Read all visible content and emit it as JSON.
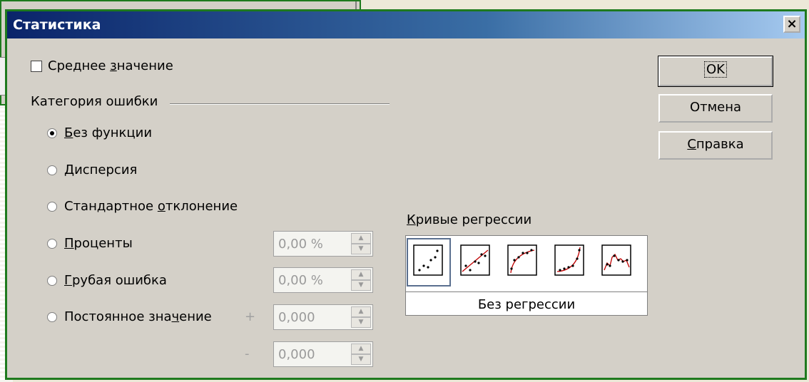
{
  "dialog": {
    "title": "Статистика",
    "close_label": "×"
  },
  "mean": {
    "label_pre": "Среднее ",
    "label_u": "з",
    "label_post": "начение",
    "checked": false
  },
  "error_category": {
    "label": "Категория ошибки",
    "options": [
      {
        "pre": "",
        "u": "Б",
        "post": "ез функции",
        "checked": true
      },
      {
        "pre": "",
        "u": "Д",
        "post": "исперсия",
        "checked": false
      },
      {
        "pre": "Стандартное ",
        "u": "о",
        "post": "тклонение",
        "checked": false
      },
      {
        "pre": "",
        "u": "П",
        "post": "роценты",
        "checked": false
      },
      {
        "pre": "",
        "u": "Г",
        "post": "рубая ошибка",
        "checked": false
      },
      {
        "pre": "Постоянное зна",
        "u": "ч",
        "post": "ение",
        "checked": false
      }
    ],
    "percent_value": "0,00 %",
    "gross_value": "0,00 %",
    "const_plus_sign": "+",
    "const_plus_value": "0,000",
    "const_minus_sign": "-",
    "const_minus_value": "0,000"
  },
  "regression": {
    "label_u": "К",
    "label_post": "ривые регрессии",
    "icons": [
      "no-regression-icon",
      "linear-regression-icon",
      "log-regression-icon",
      "exp-regression-icon",
      "power-regression-icon"
    ],
    "selected_caption": "Без регрессии"
  },
  "buttons": {
    "ok": "OK",
    "cancel": "Отмена",
    "help_u": "С",
    "help_post": "правка"
  },
  "colors": {
    "title_start": "#0a246a",
    "frame_green": "#1e7a1e",
    "curve_red": "#c00000"
  }
}
